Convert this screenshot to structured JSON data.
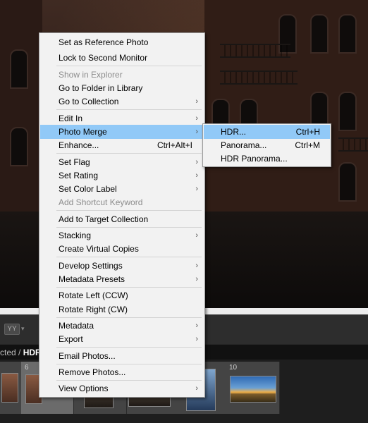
{
  "context_menu": {
    "items": [
      {
        "label": "Set as Reference Photo"
      },
      {
        "label": "Lock to Second Monitor"
      },
      {
        "label": "Show in Explorer"
      },
      {
        "label": "Go to Folder in Library"
      },
      {
        "label": "Go to Collection"
      },
      {
        "label": "Edit In"
      },
      {
        "label": "Photo Merge"
      },
      {
        "label": "Enhance...",
        "shortcut": "Ctrl+Alt+I"
      },
      {
        "label": "Set Flag"
      },
      {
        "label": "Set Rating"
      },
      {
        "label": "Set Color Label"
      },
      {
        "label": "Add Shortcut Keyword"
      },
      {
        "label": "Add to Target Collection"
      },
      {
        "label": "Stacking"
      },
      {
        "label": "Create Virtual Copies"
      },
      {
        "label": "Develop Settings"
      },
      {
        "label": "Metadata Presets"
      },
      {
        "label": "Rotate Left (CCW)"
      },
      {
        "label": "Rotate Right (CW)"
      },
      {
        "label": "Metadata"
      },
      {
        "label": "Export"
      },
      {
        "label": "Email Photos..."
      },
      {
        "label": "Remove Photos..."
      },
      {
        "label": "View Options"
      }
    ],
    "submenu_arrow": "›"
  },
  "photo_merge_submenu": {
    "items": [
      {
        "label": "HDR...",
        "shortcut": "Ctrl+H"
      },
      {
        "label": "Panorama...",
        "shortcut": "Ctrl+M"
      },
      {
        "label": "HDR Panorama..."
      }
    ]
  },
  "toolbar": {
    "view_button_label": "YY",
    "caret": "▾"
  },
  "filmstrip": {
    "path_prefix": "cted / ",
    "path_bold": "HDR-",
    "cell_numbers": [
      "6",
      "10"
    ]
  },
  "colors": {
    "menu_background": "#f2f2f2",
    "menu_highlight": "#91c9f7",
    "disabled_text": "#8c8c8c"
  }
}
